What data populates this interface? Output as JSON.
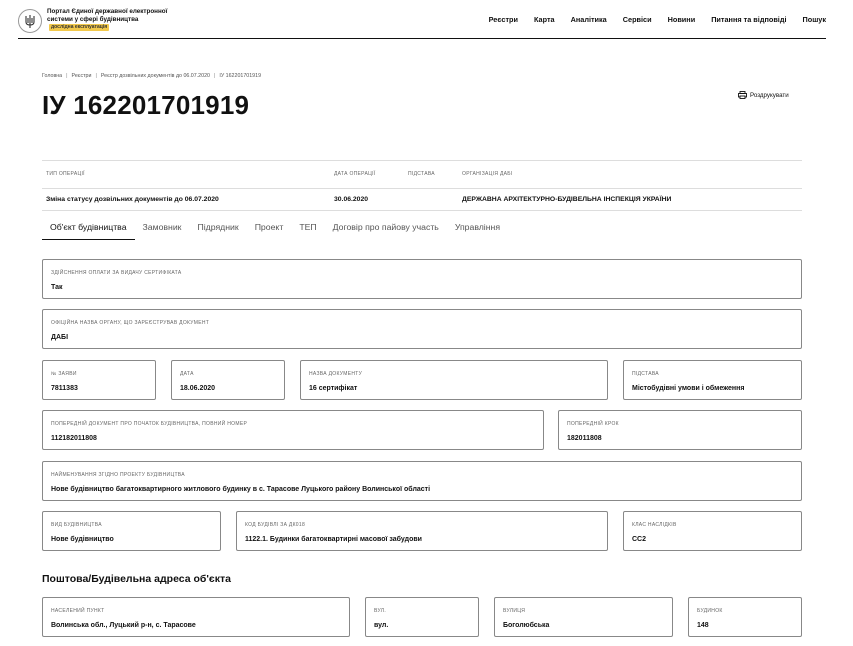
{
  "header": {
    "logo_text": "Портал Єдиної державної електронної системи у сфері будівництва",
    "logo_badge": "дослідна експлуатація",
    "nav": [
      "Реєстри",
      "Карта",
      "Аналітика",
      "Сервіси",
      "Новини",
      "Питання та відповіді",
      "Пошук"
    ]
  },
  "breadcrumb": [
    "Головна",
    "Реєстри",
    "Реєстр дозвільних документів до 06.07.2020",
    "ІУ 162201701919"
  ],
  "page": {
    "title": "ІУ 162201701919",
    "print_label": "Роздрукувати"
  },
  "operation": {
    "headers": {
      "type": "Тип операції",
      "date": "Дата операції",
      "basis": "Підстава",
      "org": "Організація ДАБІ"
    },
    "values": {
      "type": "Зміна статусу дозвільних документів до 06.07.2020",
      "date": "30.06.2020",
      "basis": "",
      "org": "ДЕРЖАВНА АРХІТЕКТУРНО-БУДІВЕЛЬНА ІНСПЕКЦІЯ УКРАЇНИ"
    }
  },
  "tabs": [
    "Об'єкт будівництва",
    "Замовник",
    "Підрядник",
    "Проект",
    "ТЕП",
    "Договір про пайову участь",
    "Управління"
  ],
  "fields": {
    "payment": {
      "label": "Здійснення оплати за видачу сертифіката",
      "value": "Так"
    },
    "authority": {
      "label": "Офіційна назва органу, що зареєстрував документ",
      "value": "ДАБІ"
    },
    "app_no": {
      "label": "№ заяви",
      "value": "7811383"
    },
    "date": {
      "label": "Дата",
      "value": "18.06.2020"
    },
    "doc_name": {
      "label": "Назва документу",
      "value": "16 сертифікат"
    },
    "basis": {
      "label": "Підстава",
      "value": "Містобудівні умови і обмеження"
    },
    "prev_doc": {
      "label": "Попередній документ про початок будівництва, повний номер",
      "value": "112182011808"
    },
    "prev_step": {
      "label": "Попередній крок",
      "value": "182011808"
    },
    "project_name": {
      "label": "Найменування згідно проекту будівництва",
      "value": "Нове будівництво багатоквартирного житлового будинку в с. Тарасове Луцького району Волинської області"
    },
    "build_type": {
      "label": "Вид будівництва",
      "value": "Нове будівництво"
    },
    "dk018": {
      "label": "Код будівлі за ДК018",
      "value": "1122.1. Будинки багатоквартирні масової забудови"
    },
    "consequence": {
      "label": "Клас наслідків",
      "value": "СС2"
    }
  },
  "address": {
    "title": "Поштова/Будівельна адреса об'єкта",
    "locality": {
      "label": "Населений пункт",
      "value": "Волинська обл., Луцький р-н, с. Тарасове"
    },
    "street_type": {
      "label": "Вул.",
      "value": "вул."
    },
    "street": {
      "label": "Вулиця",
      "value": "Боголюбська"
    },
    "building": {
      "label": "Будинок",
      "value": "148"
    }
  }
}
